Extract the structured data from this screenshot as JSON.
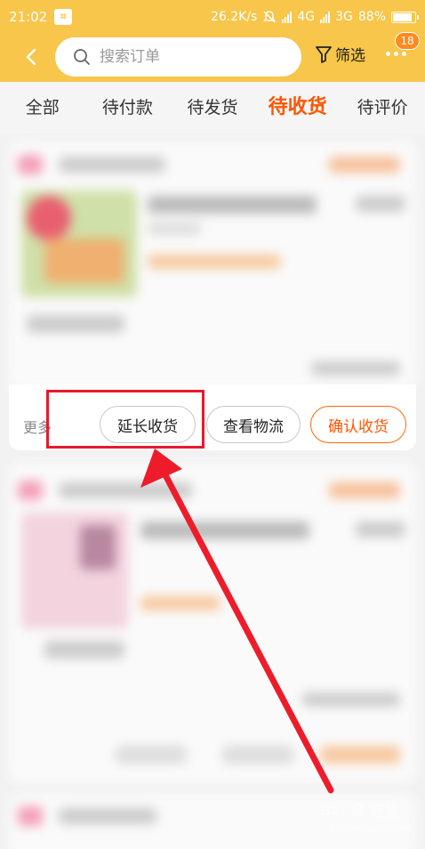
{
  "status_bar": {
    "time": "21:02",
    "speed": "26.2K/s",
    "network_4g": "4G",
    "network_3g": "3G",
    "battery": "88%",
    "battery_level": 0.88
  },
  "nav": {
    "search_placeholder": "搜索订单",
    "filter_label": "筛选",
    "badge_count": "18"
  },
  "tabs": [
    {
      "label": "全部"
    },
    {
      "label": "待付款"
    },
    {
      "label": "待发货"
    },
    {
      "label": "待收货",
      "active": true
    },
    {
      "label": "待评价"
    }
  ],
  "order": {
    "more_label": "更多",
    "extend_label": "延长收货",
    "logistics_label": "查看物流",
    "confirm_label": "确认收货"
  },
  "watermark": {
    "brand": "Bai",
    "brand_suffix": "经验",
    "url": "jingyan.baidu.com"
  },
  "colors": {
    "header": "#f7c64a",
    "accent": "#ff5500",
    "highlight": "#e8192c"
  }
}
